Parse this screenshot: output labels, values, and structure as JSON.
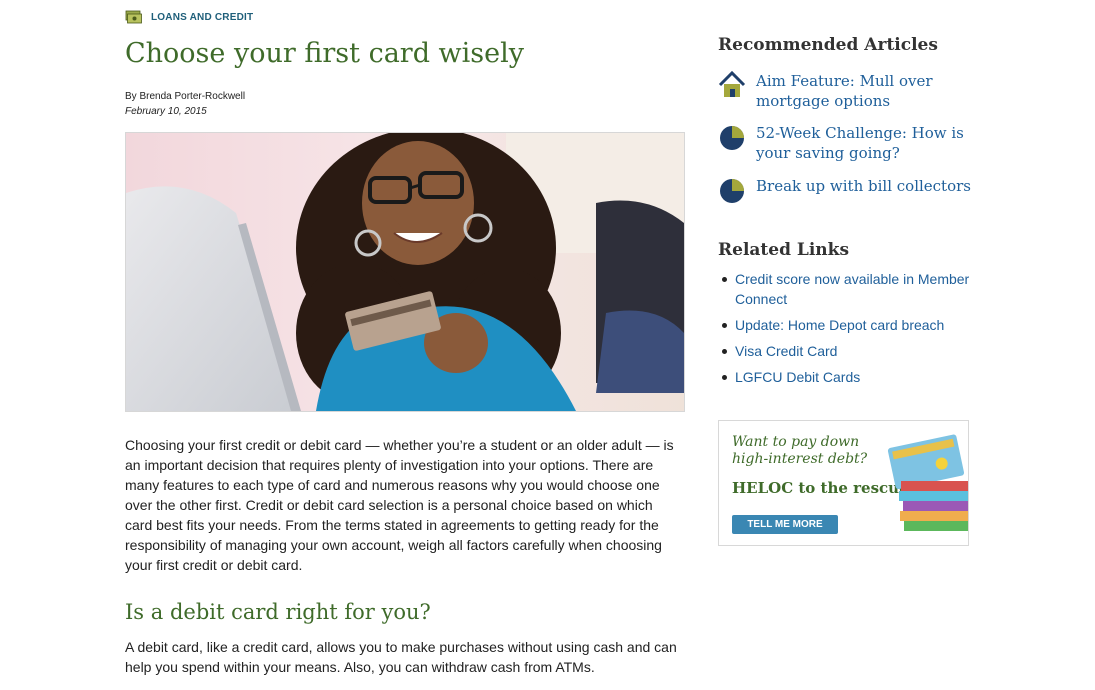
{
  "category": {
    "label": "LOANS AND CREDIT",
    "icon": "money-bills-icon"
  },
  "article": {
    "title": "Choose your first card wisely",
    "byline": "By Brenda Porter-Rockwell",
    "date": "February 10, 2015",
    "hero_image": "young woman holding a credit card in front of a laptop",
    "paragraph1": "Choosing your first credit or debit card — whether you’re a student or an older adult — is an important decision that requires plenty of investigation into your options. There are many features to each type of card and numerous reasons why you would choose one over the other first. Credit or debit card selection is a personal choice based on which card best fits your needs. From the terms stated in agreements to getting ready for the responsibility of managing your own account, weigh all factors carefully when choosing your first credit or debit card.",
    "subheading": "Is a debit card right for you?",
    "paragraph2": "A debit card, like a credit card, allows you to make purchases without using cash and can help you spend within your means. Also, you can withdraw cash from ATMs."
  },
  "sidebar": {
    "recommended_heading": "Recommended Articles",
    "recommended": [
      {
        "label": "Aim Feature: Mull over mortgage options",
        "icon": "house-icon"
      },
      {
        "label": "52-Week Challenge: How is your saving going?",
        "icon": "pie-chart-icon"
      },
      {
        "label": "Break up with bill collectors",
        "icon": "pie-chart-icon"
      }
    ],
    "related_heading": "Related Links",
    "related": [
      "Credit score now available in Member Connect",
      "Update: Home Depot card breach",
      "Visa Credit Card",
      "LGFCU Debit Cards"
    ],
    "ad": {
      "line1": "Want to pay down",
      "line2": "high-interest debt?",
      "headline": "HELOC to the rescue!",
      "button": "TELL ME MORE"
    }
  },
  "colors": {
    "heading_green": "#3f6b2a",
    "link_blue": "#1f5f9a",
    "category_blue": "#1f5f7a",
    "button_blue": "#3a87b3"
  }
}
